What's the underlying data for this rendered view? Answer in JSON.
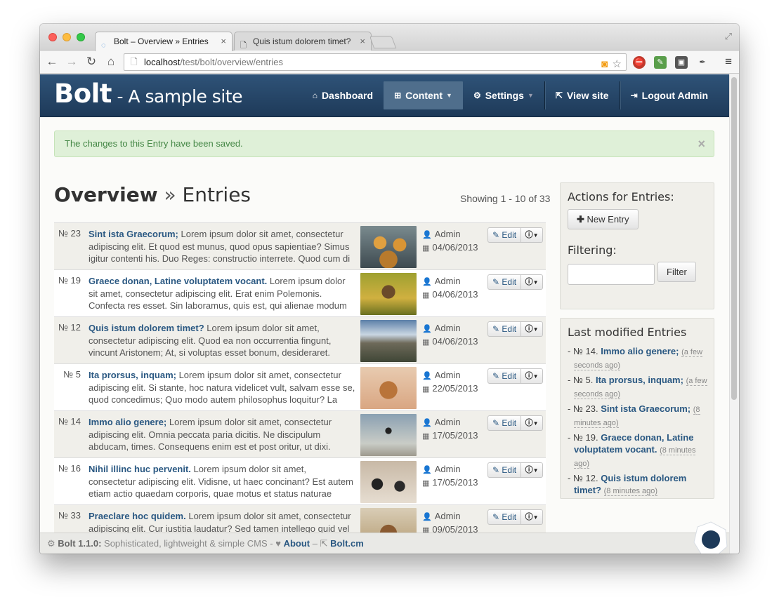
{
  "browser": {
    "tabs": [
      {
        "label": "Bolt – Overview » Entries",
        "active": true
      },
      {
        "label": "Quis istum dolorem timet?",
        "active": false
      }
    ],
    "address": {
      "host": "localhost",
      "path": "/test/bolt/overview/entries"
    }
  },
  "header": {
    "brand": "Bolt",
    "subtitle": " - A sample site",
    "nav": {
      "dashboard": "Dashboard",
      "content": "Content",
      "settings": "Settings",
      "view_site": "View site",
      "logout": "Logout Admin"
    }
  },
  "alert": {
    "message": "The changes to this Entry have been saved.",
    "close": "×"
  },
  "page": {
    "title_bold": "Overview",
    "title_sep": " » ",
    "title_rest": "Entries",
    "showing": "Showing 1 - 10 of 33"
  },
  "entries": [
    {
      "num": "№ 23",
      "title": "Sint ista Graecorum;",
      "excerpt": " Lorem ipsum dolor sit amet, consectetur adipiscing elit. Et quod est munus, quod opus sapientiae? Simus igitur contenti his. Duo Reges: constructio interrete. Quod cum di",
      "author": "Admin",
      "date": "04/06/2013",
      "edit": "Edit",
      "thumb": "monkeys"
    },
    {
      "num": "№ 19",
      "title": "Graece donan, Latine voluptatem vocant.",
      "excerpt": " Lorem ipsum dolor sit amet, consectetur adipiscing elit. Erat enim Polemonis. Confecta res esset. Sin laboramus, quis est, qui alienae modum statu",
      "author": "Admin",
      "date": "04/06/2013",
      "edit": "Edit",
      "thumb": "owl"
    },
    {
      "num": "№ 12",
      "title": "Quis istum dolorem timet?",
      "excerpt": " Lorem ipsum dolor sit amet, consectetur adipiscing elit. Quod ea non occurrentia fingunt, vincunt Aristonem; At, si voluptas esset bonum, desideraret. Itaque fecimu",
      "author": "Admin",
      "date": "04/06/2013",
      "edit": "Edit",
      "thumb": "landscape"
    },
    {
      "num": "№ 5",
      "title": "Ita prorsus, inquam;",
      "excerpt": " Lorem ipsum dolor sit amet, consectetur adipiscing elit. Si stante, hoc natura videlicet vult, salvam esse se, quod concedimus; Quo modo autem philosophus loquitur? La",
      "author": "Admin",
      "date": "22/05/2013",
      "edit": "Edit",
      "thumb": "lynx"
    },
    {
      "num": "№ 14",
      "title": "Immo alio genere;",
      "excerpt": " Lorem ipsum dolor sit amet, consectetur adipiscing elit. Omnia peccata paria dicitis. Ne discipulum abducam, times. Consequens enim est et post oritur, ut dixi. Habent eni",
      "author": "Admin",
      "date": "17/05/2013",
      "edit": "Edit",
      "thumb": "bird"
    },
    {
      "num": "№ 16",
      "title": "Nihil illinc huc pervenit.",
      "excerpt": " Lorem ipsum dolor sit amet, consectetur adipiscing elit. Vidisne, ut haec concinant? Est autem etiam actio quaedam corporis, quae motus et status naturae congruentis",
      "author": "Admin",
      "date": "17/05/2013",
      "edit": "Edit",
      "thumb": "penguins"
    },
    {
      "num": "№ 33",
      "title": "Praeclare hoc quidem.",
      "excerpt": " Lorem ipsum dolor sit amet, consectetur adipiscing elit. Cur iustitia laudatur? Sed tamen intellego quid vel",
      "author": "Admin",
      "date": "09/05/2013",
      "edit": "Edit",
      "thumb": "deer"
    }
  ],
  "sidebar": {
    "actions_title": "Actions for Entries:",
    "new_entry": "New Entry",
    "filtering_title": "Filtering:",
    "filter_button": "Filter",
    "filter_placeholder": "",
    "recent_title": "Last modified Entries",
    "recent": [
      {
        "num": "№ 14.",
        "title": "Immo alio genere;",
        "ago": "(a few seconds ago)"
      },
      {
        "num": "№ 5.",
        "title": "Ita prorsus, inquam;",
        "ago": "(a few seconds ago)"
      },
      {
        "num": "№ 23.",
        "title": "Sint ista Graecorum;",
        "ago": "(8 minutes ago)"
      },
      {
        "num": "№ 19.",
        "title": "Graece donan, Latine voluptatem vocant.",
        "ago": "(8 minutes ago)"
      },
      {
        "num": "№ 12.",
        "title": "Quis istum dolorem timet?",
        "ago": "(8 minutes ago)"
      }
    ]
  },
  "footer": {
    "version": "Bolt 1.1.0:",
    "tagline": " Sophisticated, lightweight & simple CMS - ",
    "about": "About",
    "dash": " – ",
    "site": "Bolt.cm"
  }
}
